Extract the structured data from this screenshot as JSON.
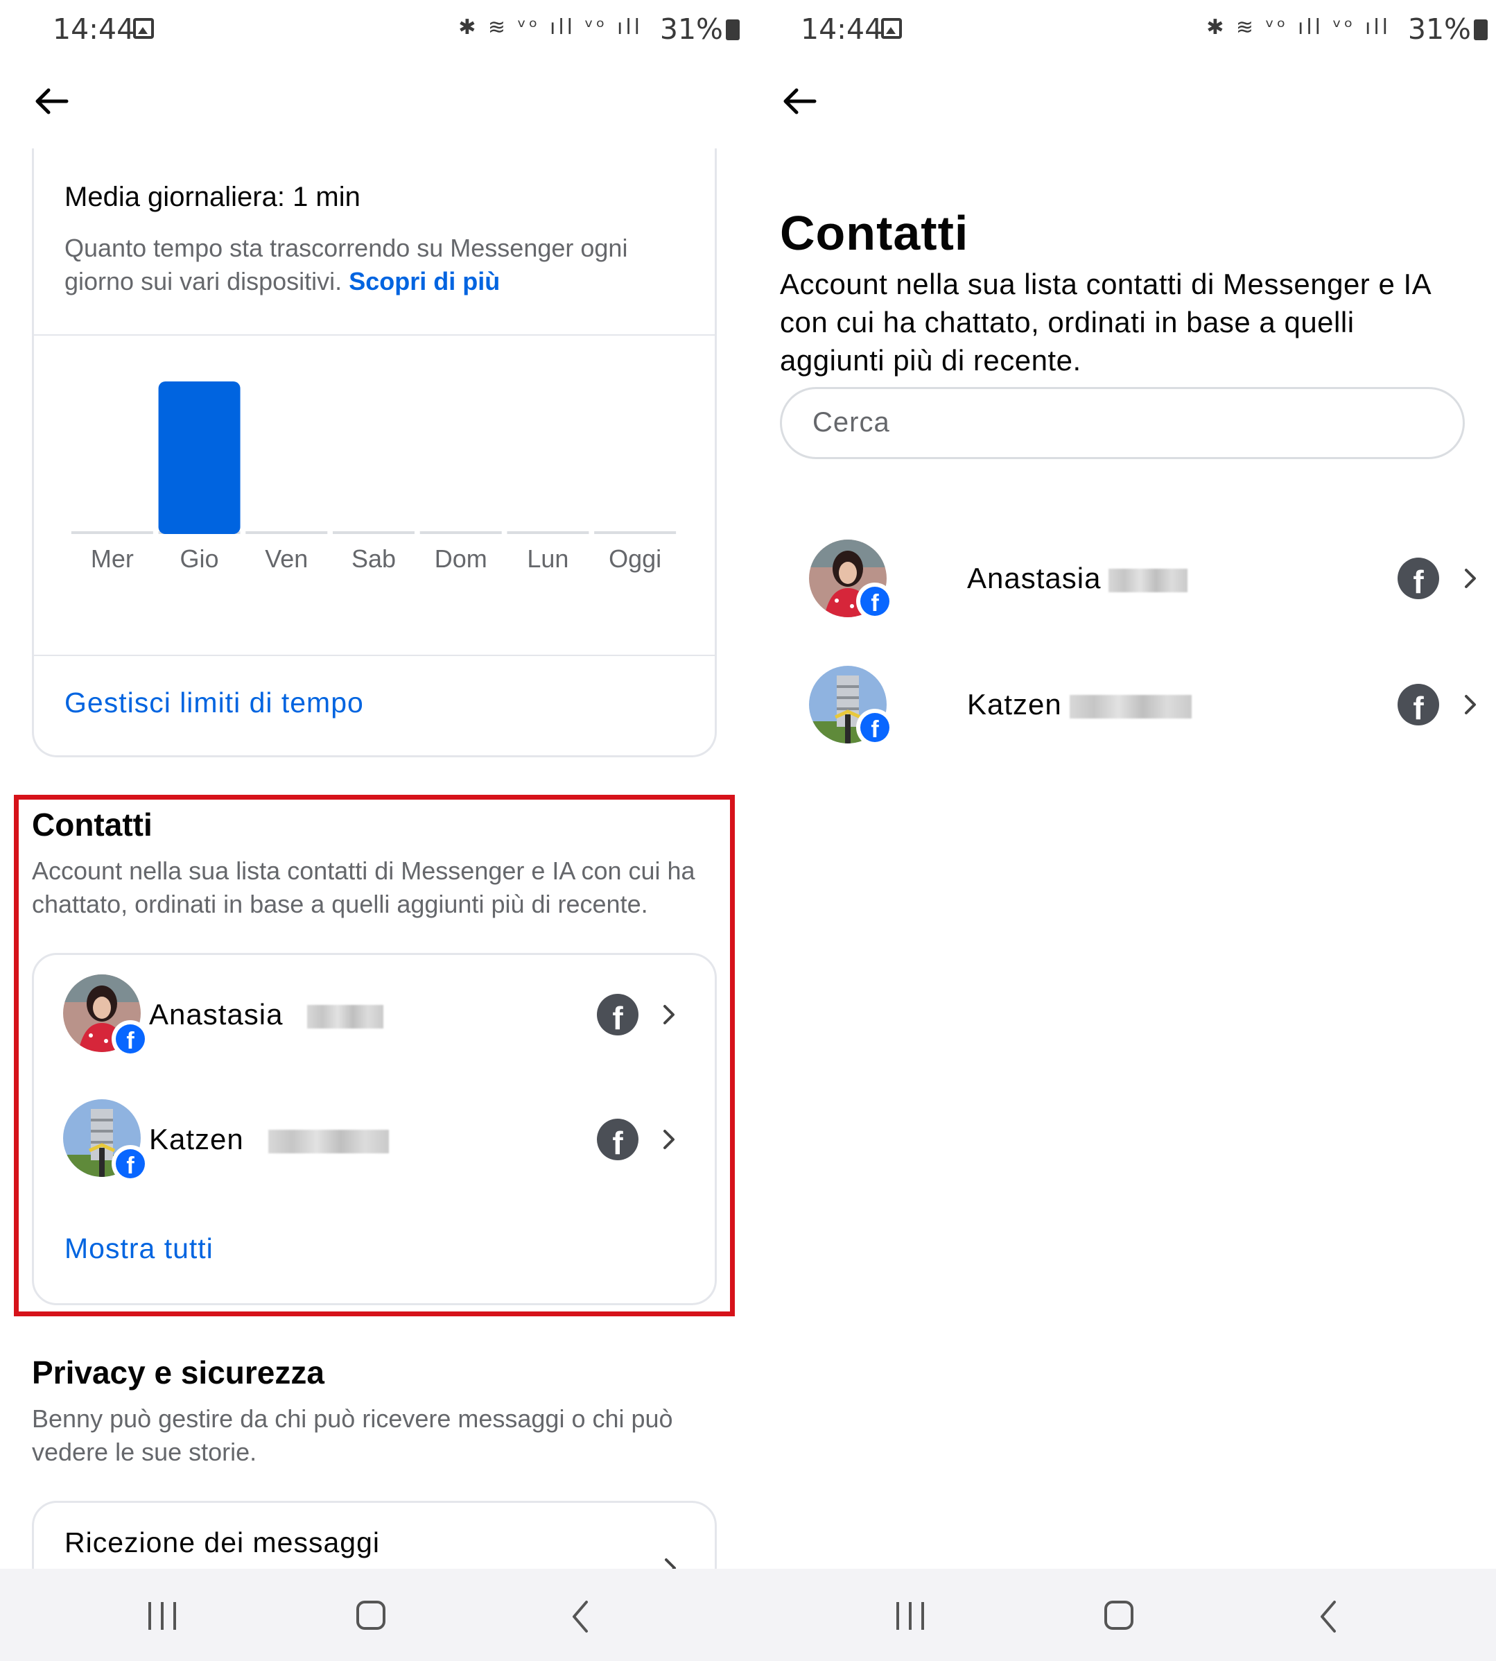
{
  "status_bar": {
    "time": "14:44",
    "network_icons": "✱ ≋ ᵛᵒ ıll ᵛᵒ ıll",
    "battery": "31%"
  },
  "left": {
    "usage_card": {
      "title": "Media giornaliera: 1 min",
      "description": "Quanto tempo sta trascorrendo su Messenger ogni giorno sui vari dispositivi.",
      "learn_more": "Scopri di più",
      "manage_limits": "Gestisci limiti di tempo"
    },
    "contacts_section": {
      "title": "Contatti",
      "description": "Account nella sua lista contatti di Messenger e IA con cui ha chattato, ordinati in base a quelli aggiunti più di recente.",
      "show_all": "Mostra tutti"
    },
    "privacy_section": {
      "title": "Privacy e sicurezza",
      "description": "Benny può gestire da chi può ricevere messaggi o chi può vedere le sue storie.",
      "first_item": "Ricezione dei messaggi"
    }
  },
  "right": {
    "title": "Contatti",
    "description": "Account nella sua lista contatti di Messenger e IA con cui ha chattato, ordinati in base a quelli aggiunti più di recente.",
    "search_placeholder": "Cerca"
  },
  "contacts": [
    {
      "first_name": "Anastasia",
      "source": "facebook"
    },
    {
      "first_name": "Katzen",
      "source": "facebook"
    }
  ],
  "chart_data": {
    "type": "bar",
    "categories": [
      "Mer",
      "Gio",
      "Ven",
      "Sab",
      "Dom",
      "Lun",
      "Oggi"
    ],
    "values": [
      0,
      1,
      0,
      0,
      0,
      0,
      0
    ],
    "ylabel": "min",
    "color": "#0064e0",
    "empty_color": "#dadde1"
  },
  "colors": {
    "accent": "#0064e0",
    "highlight_border": "#d6121a",
    "facebook_blue": "#0866ff",
    "secondary_text": "#65676b"
  }
}
